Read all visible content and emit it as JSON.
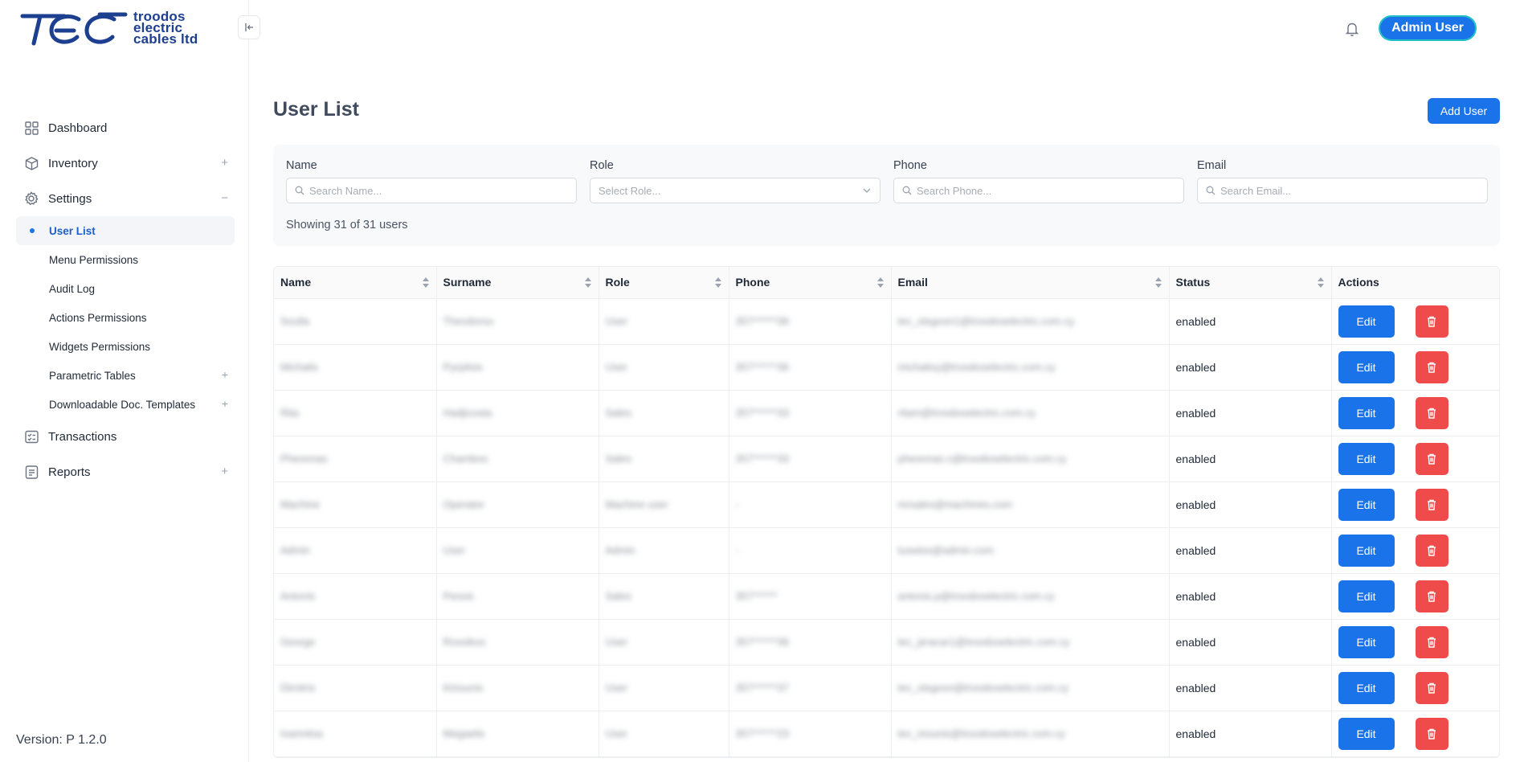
{
  "brand": {
    "line1": "troodos",
    "line2": "electric",
    "line3": "cables ltd"
  },
  "nav": {
    "dashboard": "Dashboard",
    "inventory": "Inventory",
    "settings": "Settings",
    "settings_children": [
      "User List",
      "Menu Permissions",
      "Audit Log",
      "Actions Permissions",
      "Widgets Permissions",
      "Parametric Tables",
      "Downloadable Doc. Templates"
    ],
    "transactions": "Transactions",
    "reports": "Reports",
    "expand_symbol": "+",
    "collapse_symbol": "−"
  },
  "version": "Version: P 1.2.0",
  "header": {
    "user": "Admin User"
  },
  "page": {
    "title": "User List",
    "add_button": "Add User"
  },
  "filters": {
    "name": {
      "label": "Name",
      "placeholder": "Search Name..."
    },
    "role": {
      "label": "Role",
      "placeholder": "Select Role..."
    },
    "phone": {
      "label": "Phone",
      "placeholder": "Search Phone..."
    },
    "email": {
      "label": "Email",
      "placeholder": "Search Email..."
    },
    "showing": "Showing 31 of 31 users"
  },
  "table": {
    "columns": [
      "Name",
      "Surname",
      "Role",
      "Phone",
      "Email",
      "Status",
      "Actions"
    ],
    "edit_label": "Edit",
    "rows": [
      {
        "name": "Soulla",
        "surname": "Theodorou",
        "role": "User",
        "phone": "357******36",
        "email": "tec_stsgoon1@troodoselectric.com.cy",
        "status": "enabled"
      },
      {
        "name": "Michalis",
        "surname": "Pyrpitsis",
        "role": "User",
        "phone": "357******36",
        "email": "michalisy@troodoselectric.com.cy",
        "status": "enabled"
      },
      {
        "name": "Rita",
        "surname": "Hadjicosta",
        "role": "Sales",
        "phone": "357******33",
        "email": "ritam@troodoselectric.com.cy",
        "status": "enabled"
      },
      {
        "name": "Pheonnas",
        "surname": "Chambos",
        "role": "Sales",
        "phone": "357******33",
        "email": "pheonnas.c@troodoselectric.com.cy",
        "status": "enabled"
      },
      {
        "name": "Machine",
        "surname": "Operator",
        "role": "Machine user",
        "phone": "-",
        "email": "mrsales@machines.com",
        "status": "enabled"
      },
      {
        "name": "Admin",
        "surname": "User",
        "role": "Admin",
        "phone": "-",
        "email": "tuswiss@admin.com",
        "status": "enabled"
      },
      {
        "name": "Antonis",
        "surname": "Pessis",
        "role": "Sales",
        "phone": "357******",
        "email": "antonis.p@troodoselectric.com.cy",
        "status": "enabled"
      },
      {
        "name": "George",
        "surname": "Rossikos",
        "role": "User",
        "phone": "357******36",
        "email": "tec_jeracar1@troodoselectric.com.cy",
        "status": "enabled"
      },
      {
        "name": "Dimitris",
        "surname": "Kiriounis",
        "role": "User",
        "phone": "357******37",
        "email": "tec_stsgoon@troodoselectric.com.cy",
        "status": "enabled"
      },
      {
        "name": "Ioannitsa",
        "surname": "Megaelis",
        "role": "User",
        "phone": "357******23",
        "email": "tec_iriounis@troodoselectric.com.cy",
        "status": "enabled"
      }
    ]
  },
  "colors": {
    "primary": "#1a73e8",
    "danger": "#ef4b4b",
    "brand": "#1d3f8f"
  }
}
